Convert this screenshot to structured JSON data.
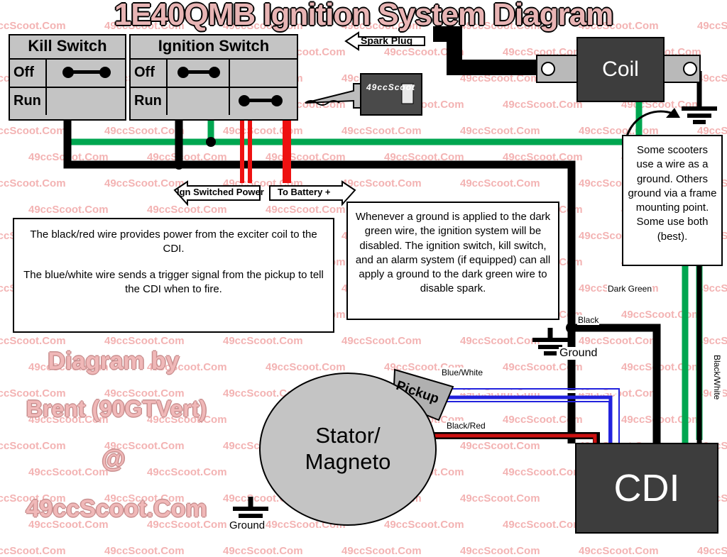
{
  "title": "1E40QMB Ignition System Diagram",
  "watermark": {
    "text": "49ccScoot.Com",
    "color": "#f3b3b3"
  },
  "byline": {
    "line1": "Diagram by",
    "line2": "Brent (90GTVert)",
    "line3": "@",
    "line4": "49ccScoot.Com"
  },
  "switches": [
    {
      "name": "Kill Switch",
      "title": "Kill Switch",
      "rows": [
        "Off",
        "Run"
      ]
    },
    {
      "name": "Ignition Switch",
      "title": "Ignition Switch",
      "rows": [
        "Off",
        "Run"
      ]
    }
  ],
  "components": {
    "coil": "Coil",
    "cdi": "CDI",
    "stator": "Stator/\nMagneto",
    "stator_line1": "Stator/",
    "stator_line2": "Magneto",
    "pickup": "Pickup",
    "spark_plug_label": "Spark Plug",
    "key_text": "49ccScoot"
  },
  "callouts": {
    "spark_plug": "Spark Plug",
    "ign_switched_power": "Ign Switched Power",
    "to_battery": "To Battery +"
  },
  "notes": {
    "left": "The black/red wire provides power from the exciter coil to the CDI.\n\nThe blue/white wire sends a trigger signal from the pickup to tell the CDI when to fire.",
    "left_p1": "The black/red wire provides power from the exciter coil to the CDI.",
    "left_p2": "The blue/white wire sends a trigger signal from the pickup to tell the CDI when to fire.",
    "middle": "Whenever a ground is applied to the dark green wire, the ignition system will be disabled. The ignition switch, kill switch, and an alarm system (if equipped) can all apply a ground to the dark green wire to disable spark.",
    "right": "Some scooters use a wire as a ground. Others ground via a frame mounting point. Some use both (best)."
  },
  "wire_labels": {
    "dark_green": "Dark Green",
    "black": "Black",
    "ground_top": "Ground",
    "ground_bottom": "Ground",
    "blue_white": "Blue/White",
    "black_red": "Black/Red",
    "black_white": "Black/White"
  },
  "colors": {
    "green": "#00a650",
    "red": "#ee1111",
    "black": "#000000",
    "blue": "#2222dd",
    "gray_body": "#c4c4c4",
    "dark_component": "#3d3d3d",
    "watermark": "#f3b3b3",
    "title_fill": "#e8b4b4"
  }
}
